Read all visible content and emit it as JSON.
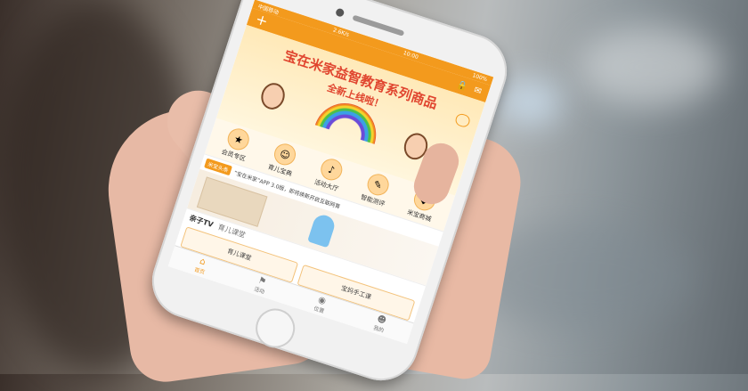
{
  "statusbar": {
    "carrier": "中国移动",
    "network": "2.6K/s",
    "time": "10:00",
    "battery": "100%"
  },
  "navbar": {
    "add_icon": "plus-icon",
    "right_icons": [
      "lock-icon",
      "mail-icon"
    ]
  },
  "banner": {
    "title": "宝在米家益智教育系列商品",
    "subtitle": "全新上线啦！"
  },
  "menu": [
    {
      "label": "会员专区",
      "icon": "member-icon"
    },
    {
      "label": "育儿宝典",
      "icon": "book-icon"
    },
    {
      "label": "活动大厅",
      "icon": "event-icon"
    },
    {
      "label": "智能测评",
      "icon": "test-icon"
    },
    {
      "label": "米宝商城",
      "icon": "shop-icon"
    }
  ],
  "news": {
    "tag": "米宝头条",
    "text": "“宝在米家”APP 3.0版，即将焕新开启互联网育"
  },
  "section": {
    "title": "亲子TV",
    "tab": "育儿课堂"
  },
  "cards": [
    {
      "label": "育儿课堂"
    },
    {
      "label": "宝妈手工课"
    }
  ],
  "tabbar": [
    {
      "label": "首页",
      "icon": "home-icon"
    },
    {
      "label": "活动",
      "icon": "flag-icon"
    },
    {
      "label": "位置",
      "icon": "location-icon"
    },
    {
      "label": "我的",
      "icon": "user-icon"
    }
  ],
  "colors": {
    "accent": "#f39a1d",
    "banner_red": "#e0452f"
  }
}
